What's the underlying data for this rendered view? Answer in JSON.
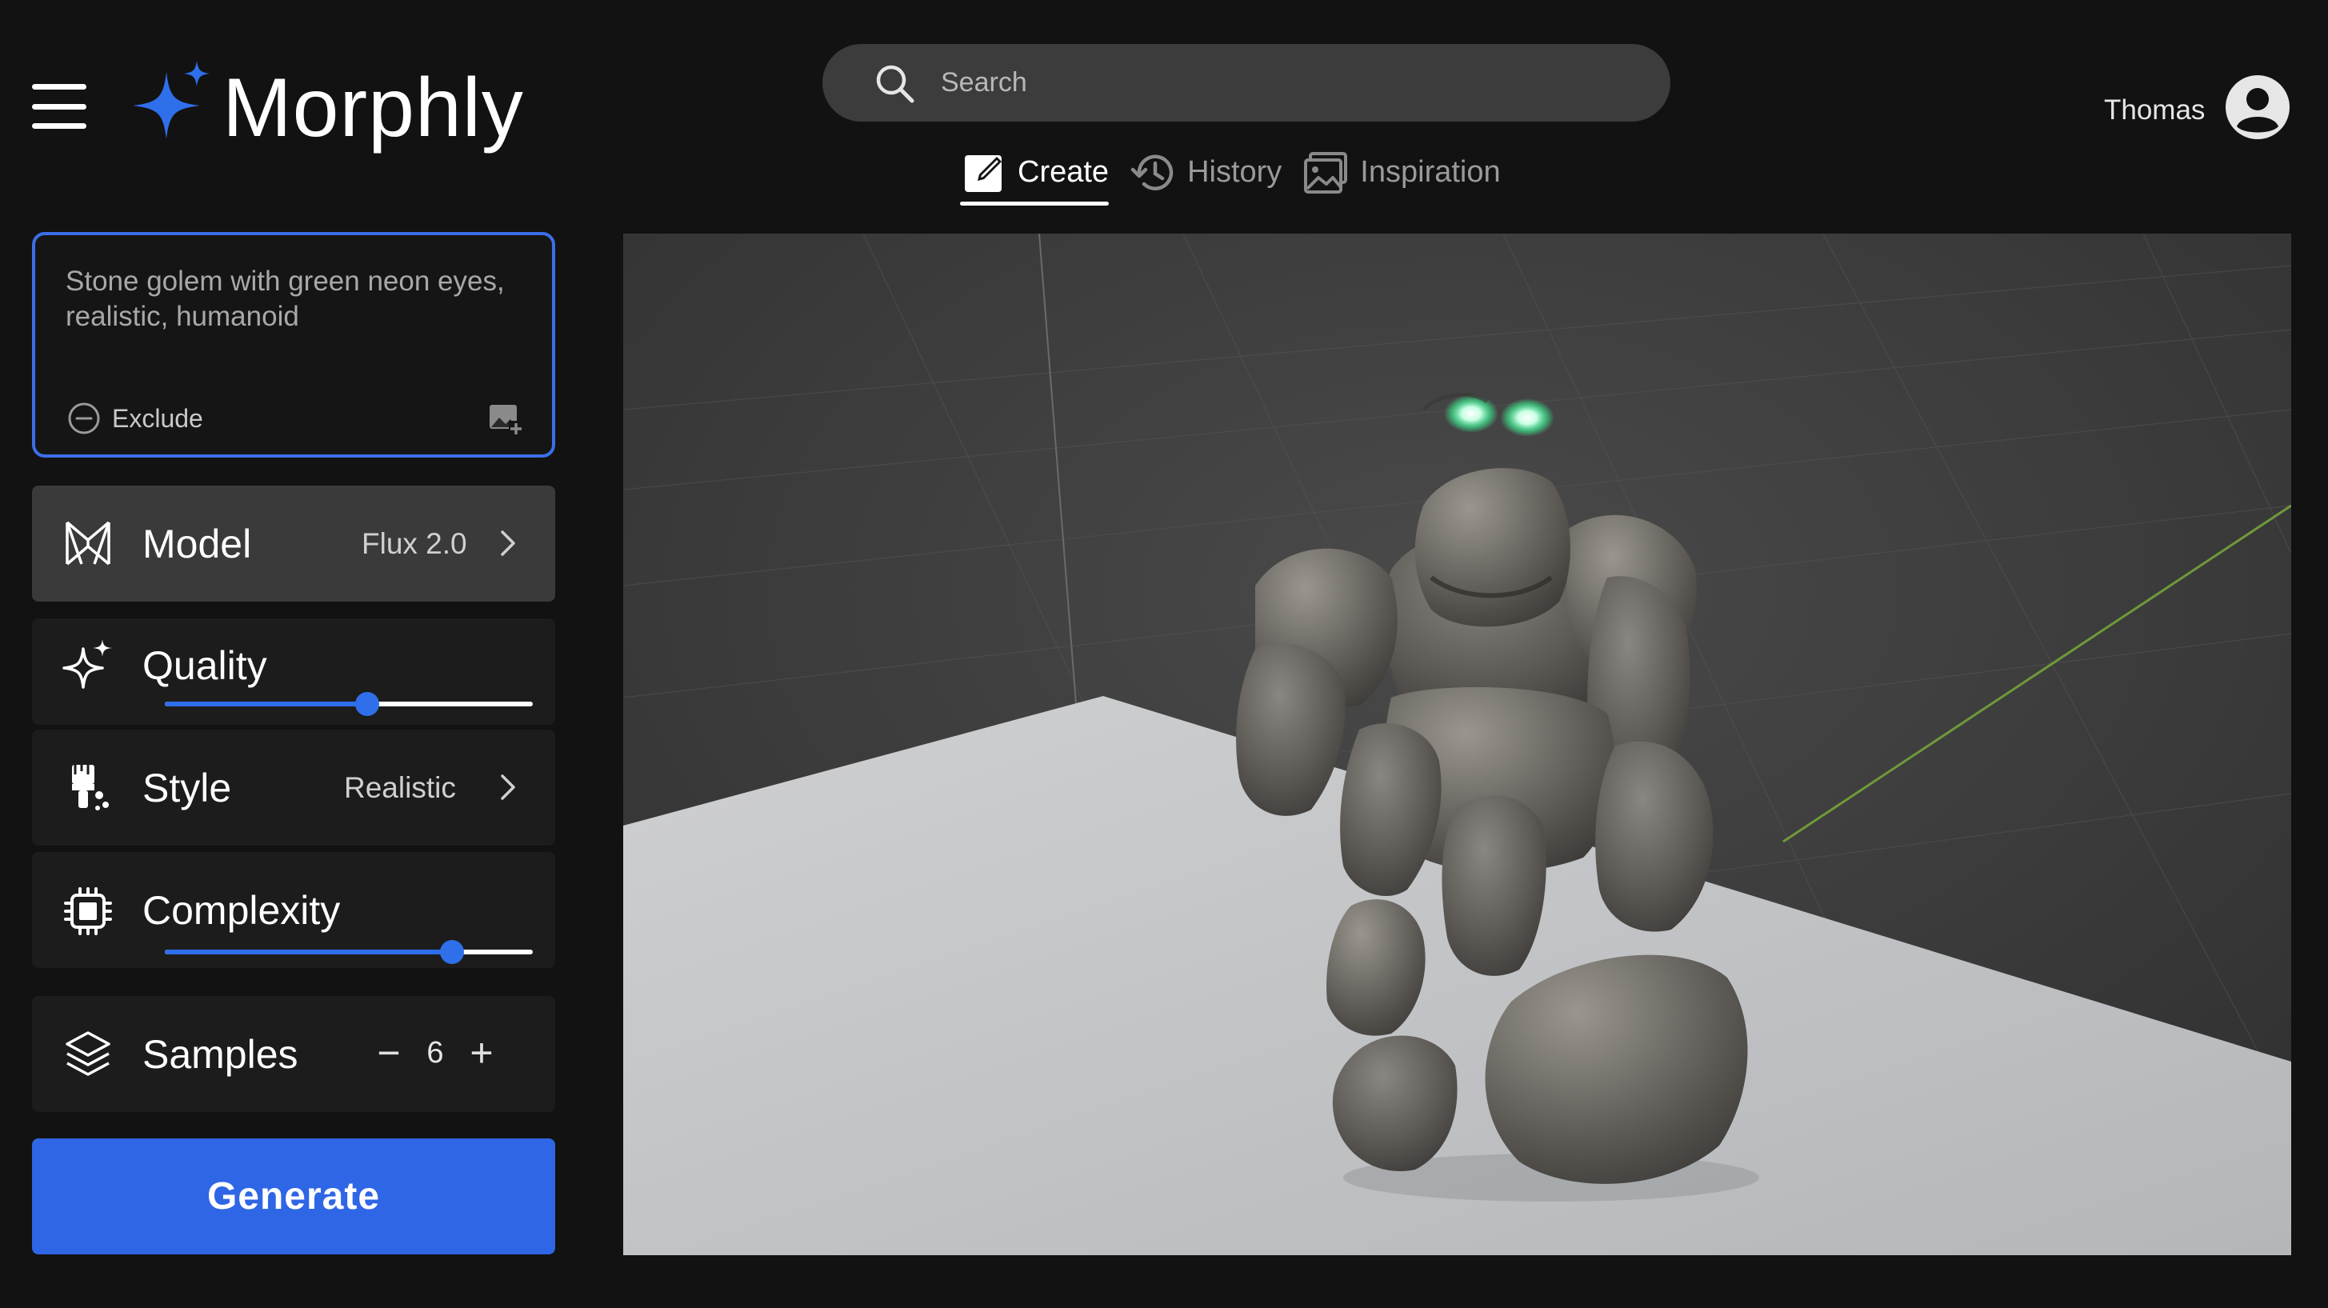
{
  "app": {
    "name": "Morphly"
  },
  "header": {
    "search_placeholder": "Search",
    "user_name": "Thomas"
  },
  "tabs": [
    {
      "label": "Create",
      "icon": "edit-icon",
      "active": true
    },
    {
      "label": "History",
      "icon": "history-icon",
      "active": false
    },
    {
      "label": "Inspiration",
      "icon": "image-icon",
      "active": false
    }
  ],
  "prompt": {
    "text": "Stone golem with green neon eyes, realistic, humanoid",
    "exclude_label": "Exclude"
  },
  "settings": {
    "model": {
      "label": "Model",
      "value": "Flux 2.0"
    },
    "quality": {
      "label": "Quality",
      "level": 0.55
    },
    "style": {
      "label": "Style",
      "value": "Realistic"
    },
    "complexity": {
      "label": "Complexity",
      "level": 0.78
    },
    "samples": {
      "label": "Samples",
      "value": "6",
      "minus": "−",
      "plus": "+"
    }
  },
  "generate_label": "Generate",
  "colors": {
    "accent": "#2f66e6",
    "background": "#121212",
    "panel": "#1c1c1c",
    "panel_selected": "#3a3a3a"
  }
}
